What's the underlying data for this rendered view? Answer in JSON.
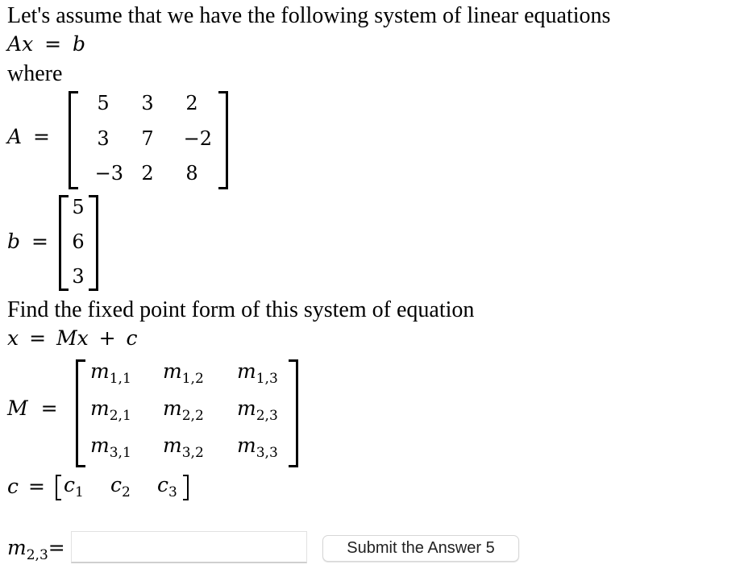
{
  "intro": {
    "line1": "Let's assume that we have the following system of linear equations",
    "equation": {
      "lhs_matrix": "A",
      "lhs_var": "x",
      "equals": "=",
      "rhs": "b"
    },
    "where": "where"
  },
  "matrix_A": {
    "label": "A",
    "equals": "=",
    "rows": [
      [
        "5",
        "3",
        "2"
      ],
      [
        "3",
        "7",
        "−2"
      ],
      [
        "−3",
        "2",
        "8"
      ]
    ]
  },
  "vector_b": {
    "label": "b",
    "equals": "=",
    "values": [
      "5",
      "6",
      "3"
    ]
  },
  "task": {
    "text": "Find the fixed point form of this system of equation",
    "equation": {
      "lhs": "x",
      "equals": "=",
      "M": "M",
      "x": "x",
      "plus": "+",
      "c": "c"
    }
  },
  "matrix_M": {
    "label": "M",
    "equals": "=",
    "symbol": "m",
    "rows": [
      [
        "1,1",
        "1,2",
        "1,3"
      ],
      [
        "2,1",
        "2,2",
        "2,3"
      ],
      [
        "3,1",
        "3,2",
        "3,3"
      ]
    ]
  },
  "vector_c": {
    "label": "c",
    "equals": "=",
    "symbol": "c",
    "subs": [
      "1",
      "2",
      "3"
    ]
  },
  "answer": {
    "symbol": "m",
    "sub": "2,3",
    "equals": "=",
    "input_value": "",
    "input_placeholder": "",
    "submit_label": "Submit the Answer 5"
  }
}
